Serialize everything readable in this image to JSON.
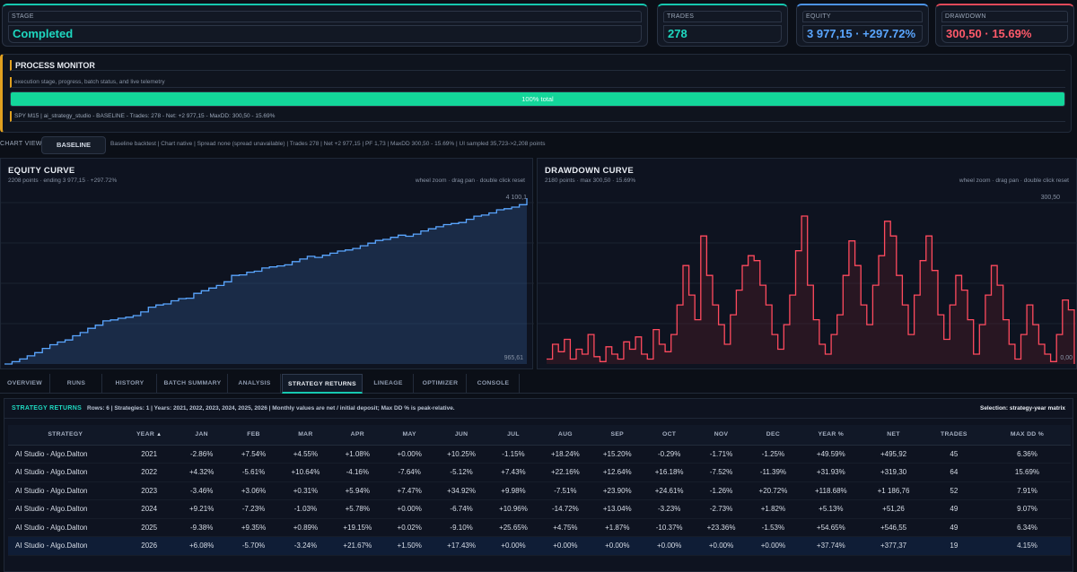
{
  "stats": {
    "stage": {
      "label": "STAGE",
      "value": "Completed"
    },
    "trades": {
      "label": "TRADES",
      "value": "278"
    },
    "equity": {
      "label": "EQUITY",
      "value": "3 977,15 · +297.72%"
    },
    "drawdown": {
      "label": "DRAWDOWN",
      "value": "300,50 · 15.69%"
    }
  },
  "process_monitor": {
    "title": "PROCESS MONITOR",
    "subtitle": "execution stage, progress, batch status, and live telemetry",
    "progress_pct": 100,
    "progress_text": "100% total",
    "status": "SPY M15 | ai_strategy_studio - BASELINE - Trades: 278 - Net: +2 977,15 - MaxDD: 300,50 - 15.69%"
  },
  "chart_view": {
    "label": "CHART VIEW",
    "button": "BASELINE",
    "meta": "Baseline backtest | Chart native | Spread none (spread unavailable) | Trades 278 | Net +2 977,15 | PF 1,73 | MaxDD 300,50 - 15.69% | UI sampled 35,723->2,208 points"
  },
  "equity_panel": {
    "title": "EQUITY CURVE",
    "subtitle": "2208 points · ending 3 977,15 · +297.72%",
    "hint": "wheel zoom · drag pan · double click reset",
    "max_label": "4 100,1",
    "min_label": "965,61"
  },
  "drawdown_panel": {
    "title": "DRAWDOWN CURVE",
    "subtitle": "2180 points · max 300,50 · 15.69%",
    "hint": "wheel zoom · drag pan · double click reset",
    "max_label": "300,50",
    "min_label": "0,00"
  },
  "chart_data": [
    {
      "type": "line",
      "title": "EQUITY CURVE",
      "ylim": [
        965.61,
        4100.1
      ],
      "series": [
        {
          "values": [
            965.61,
            1010,
            1060,
            1120,
            1180,
            1260,
            1330,
            1380,
            1420,
            1500,
            1560,
            1640,
            1700,
            1780,
            1800,
            1830,
            1850,
            1880,
            1950,
            2040,
            2080,
            2100,
            2160,
            2200,
            2210,
            2300,
            2350,
            2400,
            2450,
            2520,
            2640,
            2650,
            2700,
            2720,
            2780,
            2800,
            2820,
            2840,
            2900,
            2950,
            3000,
            2980,
            3020,
            3060,
            3100,
            3120,
            3150,
            3200,
            3250,
            3300,
            3320,
            3360,
            3400,
            3380,
            3420,
            3480,
            3520,
            3560,
            3600,
            3620,
            3640,
            3700,
            3760,
            3780,
            3820,
            3880,
            3900,
            3930,
            3977.15,
            4100.1
          ]
        }
      ],
      "grid": true
    },
    {
      "type": "line",
      "title": "DRAWDOWN CURVE",
      "ylim": [
        0,
        300.5
      ],
      "series": [
        {
          "values": [
            10,
            40,
            25,
            50,
            10,
            30,
            20,
            60,
            15,
            5,
            35,
            20,
            10,
            45,
            30,
            55,
            20,
            10,
            70,
            40,
            25,
            60,
            120,
            200,
            140,
            90,
            260,
            180,
            120,
            80,
            40,
            100,
            150,
            200,
            220,
            210,
            160,
            120,
            60,
            30,
            80,
            140,
            230,
            300.5,
            160,
            90,
            40,
            20,
            60,
            100,
            180,
            250,
            200,
            120,
            80,
            160,
            220,
            290,
            260,
            180,
            120,
            60,
            140,
            210,
            260,
            190,
            100,
            50,
            120,
            180,
            150,
            90,
            20,
            80,
            140,
            200,
            160,
            90,
            40,
            10,
            60,
            120,
            80,
            40,
            20,
            5,
            60,
            130,
            110,
            0
          ]
        }
      ],
      "grid": true
    }
  ],
  "tabs": [
    "OVERVIEW",
    "RUNS",
    "HISTORY",
    "BATCH SUMMARY",
    "ANALYSIS",
    "STRATEGY RETURNS",
    "LINEAGE",
    "OPTIMIZER",
    "CONSOLE"
  ],
  "returns": {
    "title": "STRATEGY RETURNS",
    "meta": "Rows: 6 | Strategies: 1 | Years: 2021, 2022, 2023, 2024, 2025, 2026 | Monthly values are net / initial deposit; Max DD % is peak-relative.",
    "selection": "Selection: strategy-year matrix",
    "columns": [
      "STRATEGY",
      "YEAR",
      "JAN",
      "FEB",
      "MAR",
      "APR",
      "MAY",
      "JUN",
      "JUL",
      "AUG",
      "SEP",
      "OCT",
      "NOV",
      "DEC",
      "YEAR %",
      "NET",
      "TRADES",
      "MAX DD %"
    ],
    "rows": [
      [
        "AI Studio - Algo.Dalton",
        "2021",
        "-2.86%",
        "+7.54%",
        "+4.55%",
        "+1.08%",
        "+0.00%",
        "+10.25%",
        "-1.15%",
        "+18.24%",
        "+15.20%",
        "-0.29%",
        "-1.71%",
        "-1.25%",
        "+49.59%",
        "+495,92",
        "45",
        "6.36%"
      ],
      [
        "AI Studio - Algo.Dalton",
        "2022",
        "+4.32%",
        "-5.61%",
        "+10.64%",
        "-4.16%",
        "-7.64%",
        "-5.12%",
        "+7.43%",
        "+22.16%",
        "+12.64%",
        "+16.18%",
        "-7.52%",
        "-11.39%",
        "+31.93%",
        "+319,30",
        "64",
        "15.69%"
      ],
      [
        "AI Studio - Algo.Dalton",
        "2023",
        "-3.46%",
        "+3.06%",
        "+0.31%",
        "+5.94%",
        "+7.47%",
        "+34.92%",
        "+9.98%",
        "-7.51%",
        "+23.90%",
        "+24.61%",
        "-1.26%",
        "+20.72%",
        "+118.68%",
        "+1 186,76",
        "52",
        "7.91%"
      ],
      [
        "AI Studio - Algo.Dalton",
        "2024",
        "+9.21%",
        "-7.23%",
        "-1.03%",
        "+5.78%",
        "+0.00%",
        "-6.74%",
        "+10.96%",
        "-14.72%",
        "+13.04%",
        "-3.23%",
        "-2.73%",
        "+1.82%",
        "+5.13%",
        "+51,26",
        "49",
        "9.07%"
      ],
      [
        "AI Studio - Algo.Dalton",
        "2025",
        "-9.38%",
        "+9.35%",
        "+0.89%",
        "+19.15%",
        "+0.02%",
        "-9.10%",
        "+25.65%",
        "+4.75%",
        "+1.87%",
        "-10.37%",
        "+23.36%",
        "-1.53%",
        "+54.65%",
        "+546,55",
        "49",
        "6.34%"
      ],
      [
        "AI Studio - Algo.Dalton",
        "2026",
        "+6.08%",
        "-5.70%",
        "-3.24%",
        "+21.67%",
        "+1.50%",
        "+17.43%",
        "+0.00%",
        "+0.00%",
        "+0.00%",
        "+0.00%",
        "+0.00%",
        "+0.00%",
        "+37.74%",
        "+377,37",
        "19",
        "4.15%"
      ]
    ]
  },
  "colors": {
    "accent": "#16c8b0",
    "equity": "#4d94e8",
    "drawdown": "#e04a5a",
    "progress": "#13d69a",
    "warning": "#e0a020"
  }
}
